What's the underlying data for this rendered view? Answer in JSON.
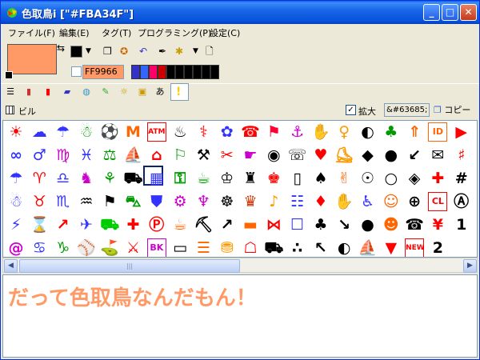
{
  "window": {
    "title": "色取鳥i [\"#FBA34F\"]",
    "minimize_glyph": "_",
    "maximize_glyph": "□",
    "close_glyph": "✕"
  },
  "menu": [
    {
      "label": "ファイル(F)"
    },
    {
      "label": "編集(E)"
    },
    {
      "label": "タグ(T)"
    },
    {
      "label": "プログラミング(P)"
    },
    {
      "label": "設定(C)"
    }
  ],
  "toolbar": {
    "current_color": "#FF9966",
    "hex_value": "FF9966",
    "palette_colors": [
      "#3333CC",
      "#3366FF",
      "#FF0066",
      "#CC0000",
      "#000000",
      "#000000",
      "#000000",
      "#000000",
      "#000000",
      "#000000"
    ],
    "tool_icons": [
      "copy-icon",
      "palette-icon",
      "undo-icon",
      "eyedropper-icon",
      "special-char-icon",
      "new-doc-icon"
    ],
    "category_icons": [
      "list-icon",
      "multicolor-bars-icon",
      "red-bars-icon",
      "chart-icon",
      "globe-icon",
      "green-pencil-icon",
      "bulb-icon",
      "picture-icon",
      "hiragana-icon",
      "exclamation-icon"
    ],
    "hiragana_label": "あ",
    "category_label": "ビル",
    "zoom_label": "拡大",
    "zoom_checked": "✓",
    "code_value": "&#63685;",
    "copy_label": "コピー"
  },
  "grid": {
    "rows": [
      [
        [
          "☀",
          "#FF0000"
        ],
        [
          "☁",
          "#3333FF"
        ],
        [
          "☂",
          "#3333FF"
        ],
        [
          "☃",
          "#009900"
        ],
        [
          "⚽",
          "#000000"
        ],
        [
          "M",
          "#FF6600"
        ],
        [
          "ATM",
          "#FF0000"
        ],
        [
          "♨",
          "#000000"
        ],
        [
          "⚕",
          "#FF0000"
        ],
        [
          "✿",
          "#3333FF"
        ],
        [
          "☎",
          "#FF0000"
        ],
        [
          "⚑",
          "#FF0033"
        ],
        [
          "⚓",
          "#CC00CC"
        ],
        [
          "✋",
          "#FF6600"
        ],
        [
          "♀",
          "#FF9900"
        ],
        [
          "◐",
          "#000000"
        ],
        [
          "♣",
          "#009900"
        ],
        [
          "⇑",
          "#FF6600"
        ],
        [
          "ID",
          "#FF6600"
        ],
        [
          "▶",
          "#FF0000"
        ]
      ],
      [
        [
          "∞",
          "#3333FF"
        ],
        [
          "♂",
          "#3333FF"
        ],
        [
          "♍",
          "#CC00CC"
        ],
        [
          "♓",
          "#3333FF"
        ],
        [
          "⚖",
          "#009900"
        ],
        [
          "⛵",
          "#3333FF"
        ],
        [
          "⌂",
          "#FF0000"
        ],
        [
          "⚐",
          "#009900"
        ],
        [
          "⚒",
          "#000000"
        ],
        [
          "✂",
          "#FF0000"
        ],
        [
          "☛",
          "#CC00CC"
        ],
        [
          "◉",
          "#000000"
        ],
        [
          "☏",
          "#000000"
        ],
        [
          "♥",
          "#FF0000"
        ],
        [
          "⛸",
          "#FF9900"
        ],
        [
          "◆",
          "#000000"
        ],
        [
          "●",
          "#000000"
        ],
        [
          "↙",
          "#000000"
        ],
        [
          "✉",
          "#000000"
        ],
        [
          "♯",
          "#FF0000"
        ]
      ],
      [
        [
          "☂",
          "#3333FF"
        ],
        [
          "♈",
          "#FF0000"
        ],
        [
          "♎",
          "#3333FF"
        ],
        [
          "♞",
          "#CC00CC"
        ],
        [
          "⚘",
          "#009900"
        ],
        [
          "⛟",
          "#000000"
        ],
        [
          "▦",
          "#3333FF"
        ],
        [
          "⚿",
          "#009900"
        ],
        [
          "☕",
          "#009900"
        ],
        [
          "♔",
          "#000000"
        ],
        [
          "♜",
          "#000000"
        ],
        [
          "♚",
          "#FF0000"
        ],
        [
          "▯",
          "#000000"
        ],
        [
          "♠",
          "#000000"
        ],
        [
          "✌",
          "#FF6600"
        ],
        [
          "☉",
          "#000000"
        ],
        [
          "○",
          "#000000"
        ],
        [
          "◈",
          "#000000"
        ],
        [
          "✚",
          "#FF0000"
        ],
        [
          "#",
          "#000000"
        ]
      ],
      [
        [
          "☃",
          "#3333FF"
        ],
        [
          "♉",
          "#FF0000"
        ],
        [
          "♏",
          "#3333FF"
        ],
        [
          "♒",
          "#000000"
        ],
        [
          "⚑",
          "#000000"
        ],
        [
          "⛍",
          "#009900"
        ],
        [
          "⛊",
          "#3333FF"
        ],
        [
          "⚙",
          "#CC00CC"
        ],
        [
          "♆",
          "#CC00CC"
        ],
        [
          "☸",
          "#000000"
        ],
        [
          "♛",
          "#CC3300"
        ],
        [
          "♪",
          "#FF9900"
        ],
        [
          "☷",
          "#3333FF"
        ],
        [
          "♦",
          "#FF0000"
        ],
        [
          "✋",
          "#FF6600"
        ],
        [
          "♿",
          "#3333FF"
        ],
        [
          "☺",
          "#FF6600"
        ],
        [
          "⊕",
          "#000000"
        ],
        [
          "CL",
          "#FF0000"
        ],
        [
          "Ⓐ",
          "#000000"
        ]
      ],
      [
        [
          "⚡",
          "#3333FF"
        ],
        [
          "⌛",
          "#3333FF"
        ],
        [
          "↗",
          "#FF0000"
        ],
        [
          "✈",
          "#3333FF"
        ],
        [
          "⛟",
          "#00CC00"
        ],
        [
          "✚",
          "#FF0000"
        ],
        [
          "Ⓟ",
          "#FF0000"
        ],
        [
          "☕",
          "#FF6600"
        ],
        [
          "⛏",
          "#000000"
        ],
        [
          "↗",
          "#000000"
        ],
        [
          "▬",
          "#FF6600"
        ],
        [
          "⋈",
          "#FF0000"
        ],
        [
          "☐",
          "#3333FF"
        ],
        [
          "♣",
          "#000000"
        ],
        [
          "↘",
          "#000000"
        ],
        [
          "●",
          "#000000"
        ],
        [
          "☻",
          "#FF6600"
        ],
        [
          "☎",
          "#000000"
        ],
        [
          "¥",
          "#FF0000"
        ],
        [
          "1",
          "#000000"
        ]
      ],
      [
        [
          "@",
          "#CC00CC"
        ],
        [
          "♋",
          "#3333FF"
        ],
        [
          "♑",
          "#009900"
        ],
        [
          "⚾",
          "#009900"
        ],
        [
          "⛳",
          "#009900"
        ],
        [
          "⚔",
          "#FF0000"
        ],
        [
          "BK",
          "#CC00CC"
        ],
        [
          "▭",
          "#000000"
        ],
        [
          "☰",
          "#FF6600"
        ],
        [
          "⛃",
          "#FF9900"
        ],
        [
          "☖",
          "#FF0000"
        ],
        [
          "⛟",
          "#000000"
        ],
        [
          "∴",
          "#000000"
        ],
        [
          "↖",
          "#000000"
        ],
        [
          "◐",
          "#000000"
        ],
        [
          "⛵",
          "#3333FF"
        ],
        [
          "▼",
          "#FF0000"
        ],
        [
          "NEW",
          "#FF0000"
        ],
        [
          "2",
          "#000000"
        ]
      ]
    ]
  },
  "scrollbar": {
    "left_arrow": "◀",
    "right_arrow": "▶",
    "thumb_grip": "|||"
  },
  "sample_text": "だって色取鳥なんだもん！"
}
